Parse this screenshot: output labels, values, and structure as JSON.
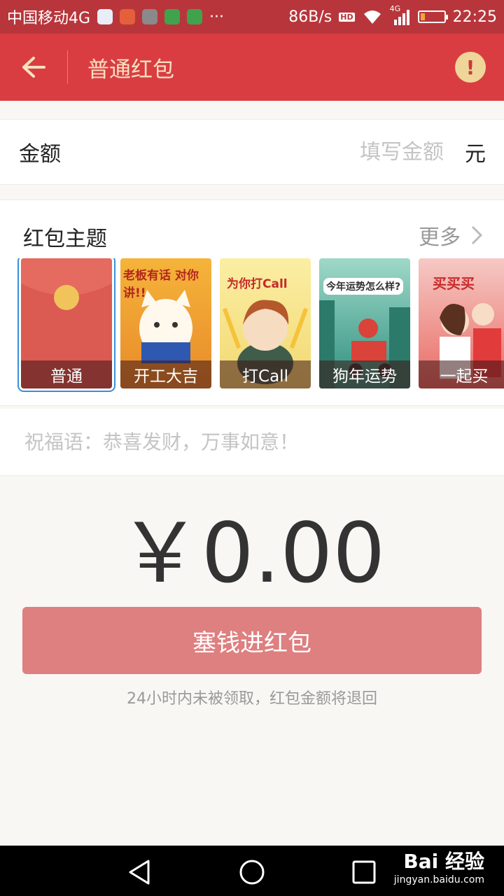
{
  "status_bar": {
    "carrier": "中国移动4G",
    "more": "···",
    "speed": "86B/s",
    "hd": "HD",
    "network": "4G",
    "time": "22:25"
  },
  "app_bar": {
    "title": "普通红包"
  },
  "amount": {
    "label": "金额",
    "placeholder": "填写金额",
    "unit": "元"
  },
  "themes": {
    "title": "红包主题",
    "more_label": "更多",
    "items": [
      {
        "label": "普通",
        "selected": true
      },
      {
        "label": "开工大吉",
        "art_text": "老板有话 对你讲!!"
      },
      {
        "label": "打Call",
        "art_text": "为你打Call"
      },
      {
        "label": "狗年运势",
        "art_text": "今年运势怎么样?"
      },
      {
        "label": "一起买",
        "art_text": "买买买"
      }
    ]
  },
  "greeting": {
    "placeholder": "祝福语：恭喜发财，万事如意！"
  },
  "total": "￥0.00",
  "submit_label": "塞钱进红包",
  "note": "24小时内未被领取，红包金额将退回",
  "watermark": {
    "brand": "Bai 经验",
    "url": "jingyan.baidu.com"
  }
}
